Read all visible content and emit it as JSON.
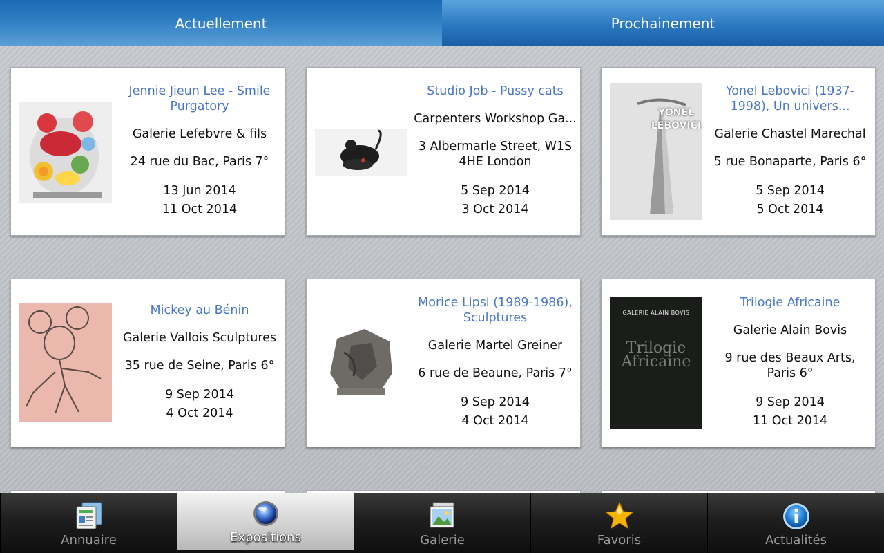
{
  "tabs": [
    {
      "label": "Actuellement",
      "active": true
    },
    {
      "label": "Prochainement",
      "active": false
    }
  ],
  "cards": [
    {
      "title": "Jennie Jieun Lee - Smile Purgatory",
      "gallery": "Galerie Lefebvre & fils",
      "address": "24 rue du Bac, Paris 7°",
      "start": "13 Jun 2014",
      "end": "11 Oct 2014",
      "thumb": "sculpture-colorful"
    },
    {
      "title": "Studio Job - Pussy cats",
      "gallery": "Carpenters Workshop Ga...",
      "address": "3 Albermarle Street, W1S 4HE London",
      "start": "5 Sep 2014",
      "end": "3 Oct 2014",
      "thumb": "black-cat-sculpture"
    },
    {
      "title": "Yonel Lebovici (1937-1998), Un univers...",
      "gallery": "Galerie Chastel Marechal",
      "address": "5 rue Bonaparte, Paris 6°",
      "start": "5 Sep 2014",
      "end": "5 Oct 2014",
      "thumb": "poster-yonel-lebovici",
      "poster_text": [
        "YONEL",
        "LEBOVICI"
      ]
    },
    {
      "title": "Mickey au Bénin",
      "gallery": "Galerie Vallois Sculptures",
      "address": "35 rue de Seine, Paris 6°",
      "start": "9 Sep 2014",
      "end": "4 Oct 2014",
      "thumb": "mickey-wire-sculpture"
    },
    {
      "title": "Morice Lipsi (1989-1986), Sculptures",
      "gallery": "Galerie Martel Greiner",
      "address": "6 rue de Beaune, Paris 7°",
      "start": "9 Sep 2014",
      "end": "4 Oct 2014",
      "thumb": "stone-sculpture"
    },
    {
      "title": "Trilogie Africaine",
      "gallery": "Galerie Alain Bovis",
      "address": "9 rue des Beaux Arts, Paris 6°",
      "start": "9 Sep 2014",
      "end": "11 Oct 2014",
      "thumb": "book-cover-trilogie",
      "poster_text": [
        "GALERIE ALAIN BOVIS",
        "Trilogie Africaine"
      ]
    }
  ],
  "bottom_nav": [
    {
      "label": "Annuaire",
      "icon": "directory-icon",
      "active": false
    },
    {
      "label": "Expositions",
      "icon": "globe-icon",
      "active": true
    },
    {
      "label": "Galerie",
      "icon": "gallery-image-icon",
      "active": false
    },
    {
      "label": "Favoris",
      "icon": "star-icon",
      "active": false
    },
    {
      "label": "Actualités",
      "icon": "info-icon",
      "active": false
    }
  ],
  "colors": {
    "accent_blue": "#2f7fc4",
    "title_blue": "#4a78c9",
    "star": "#f5b400",
    "info_blue": "#1f7fd6"
  }
}
